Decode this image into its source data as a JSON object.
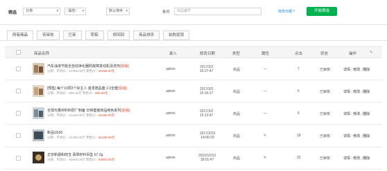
{
  "filter": {
    "label": "筛选",
    "category_select": "分类:",
    "attribute_select": "-属性-",
    "sort_select": "默认排序",
    "condition_label": "条件",
    "search_field": "商品编号",
    "link_text": "修改日期 ?",
    "search_button": "开始筛选"
  },
  "tabs": [
    "所有商品",
    "待审核",
    "已审",
    "草稿",
    "修回回",
    "商品排序",
    "拍购促销"
  ],
  "table": {
    "headers": {
      "name": "商品名称",
      "author": "录入",
      "date": "修改日期",
      "type": "类型",
      "attr": "属性",
      "clicks": "点击",
      "status": "状态",
      "ops": "操作"
    },
    "rows": [
      {
        "title": "汽车油液节能全自动净化器防故障发动机清洗剂",
        "promo": "[促销]",
        "market_price": "¥1258.00元",
        "sale_price": "¥1258.00元",
        "author": "admin",
        "date1": "2017/3/2",
        "date2": "15:27:47",
        "type": "商品",
        "attr": "—",
        "clicks": "7",
        "status": "已审核",
        "ops": [
          "详情",
          "修改",
          "删除"
        ]
      },
      {
        "title": "[预售] 每个10项3个好主人 首发赠品套 2.0全套",
        "promo": "[促销]",
        "market_price": "¥50.00元",
        "sale_price": "¥50.00元",
        "author": "admin",
        "date1": "2017/3/2",
        "date2": "15:16:17",
        "type": "商品",
        "attr": "—",
        "clicks": "5",
        "status": "已审核",
        "ops": [
          "详情",
          "修改",
          "删除"
        ]
      },
      {
        "title": "全球光量材料料原厂制备 日常套装饰品纯色系列",
        "promo": "[促销]",
        "market_price": "¥1268.00元",
        "sale_price": "¥1268.00元",
        "author": "admin",
        "date1": "2017/3/2",
        "date2": "15:12:47",
        "type": "商品",
        "attr": "—",
        "clicks": "6",
        "status": "已审核",
        "ops": [
          "详情",
          "修改",
          "删除"
        ]
      },
      {
        "title": "新品G530",
        "promo": "",
        "market_price": "¥1289.00元",
        "sale_price": "¥1289.00元",
        "author": "admin",
        "date1": "2017/2/23",
        "date2": "14:00:20",
        "type": "商品",
        "attr": "✎",
        "clicks": "18",
        "status": "已审核",
        "ops": [
          "详情",
          "修改",
          "删除"
        ]
      },
      {
        "title": "正宗新疆和田玉 翡翠籽料吊坠 67.2g",
        "promo": "",
        "market_price": "¥3600.00元",
        "sale_price": "¥4800.00元",
        "author": "admin",
        "date1": "2015/10/10",
        "date2": "18:01:47",
        "type": "商品",
        "attr": "✎",
        "clicks": "25",
        "status": "已审核",
        "ops": [
          "详情",
          "修改",
          "删除"
        ]
      }
    ],
    "price_labels": {
      "market": "市场价：",
      "sale": "零售价：",
      "stock": "分销："
    }
  }
}
